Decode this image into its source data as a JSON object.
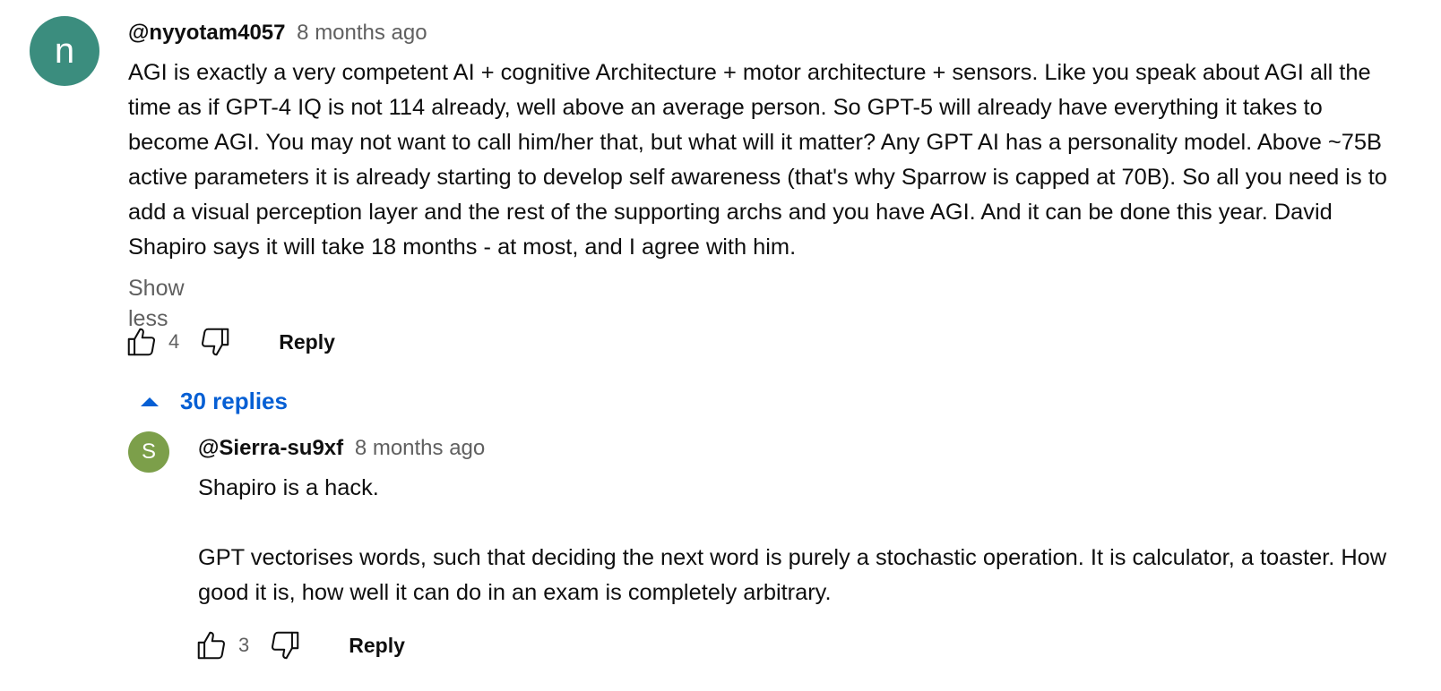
{
  "colors": {
    "avatar_main": "#3b8d7e",
    "avatar_reply": "#7c9f4a",
    "link_blue": "#065fd4",
    "meta_gray": "#606060"
  },
  "main_comment": {
    "avatar_letter": "n",
    "author": "@nyyotam4057",
    "time": "8 months ago",
    "text": "AGI is exactly a very competent AI + cognitive Architecture + motor architecture + sensors. Like you speak about AGI all the time as if GPT-4 IQ is not 114 already, well above an average person. So GPT-5 will already have everything it takes to become AGI. You may not want to call him/her that, but what will it matter? Any GPT AI has a personality model. Above ~75B active parameters it is already starting to develop self awareness (that's why Sparrow is capped at 70B). So all you need is to add a visual perception layer and the rest of the supporting archs and you have AGI. And it can be done this year. David Shapiro says it will take 18 months - at most, and I agree with him.",
    "show_less_label": "Show less",
    "like_count": "4",
    "reply_label": "Reply",
    "like_icon": "thumbs-up-icon",
    "dislike_icon": "thumbs-down-icon"
  },
  "replies_toggle": {
    "label": "30 replies",
    "icon": "caret-up-icon"
  },
  "reply_comment": {
    "avatar_letter": "S",
    "author": "@Sierra-su9xf",
    "time": "8 months ago",
    "paragraph_1": "Shapiro is a hack.",
    "paragraph_2": "GPT vectorises words, such that deciding the next word is purely a stochastic operation. It is calculator, a toaster. How good it is, how well it can do in an exam is completely arbitrary.",
    "like_count": "3",
    "reply_label": "Reply",
    "like_icon": "thumbs-up-icon",
    "dislike_icon": "thumbs-down-icon"
  }
}
